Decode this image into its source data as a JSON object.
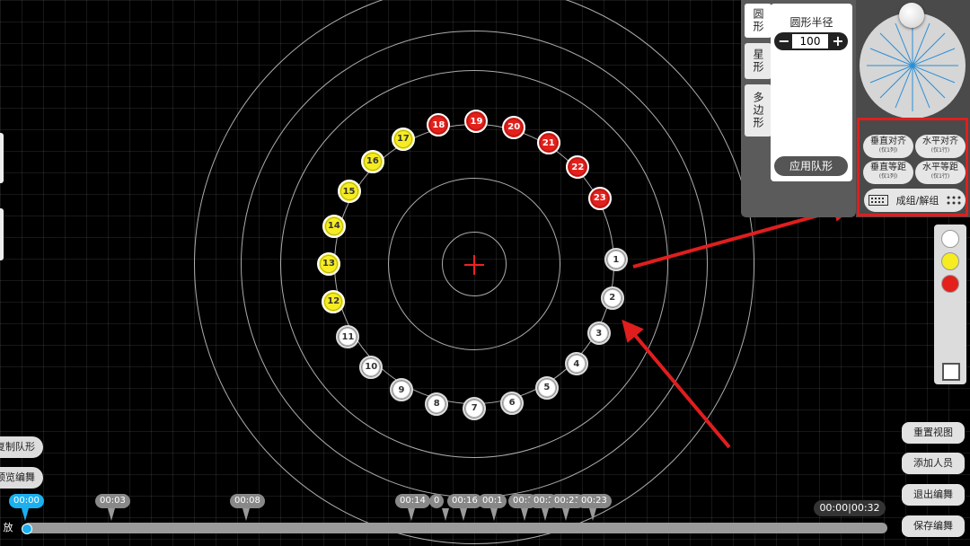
{
  "shape_tabs": [
    {
      "label": "圆形",
      "active": true
    },
    {
      "label": "星形",
      "active": false
    },
    {
      "label": "多边形",
      "active": false
    }
  ],
  "shape_settings": {
    "radius_title": "圆形半径",
    "radius_value": "100",
    "minus": "−",
    "plus": "+",
    "apply_label": "应用队形"
  },
  "align": {
    "vertical_align": {
      "label": "垂直对齐",
      "sub": "(仅1列)"
    },
    "horizontal_align": {
      "label": "水平对齐",
      "sub": "(仅1行)"
    },
    "vertical_spacing": {
      "label": "垂直等距",
      "sub": "(仅1列)"
    },
    "horizontal_spacing": {
      "label": "水平等距",
      "sub": "(仅1行)"
    },
    "group_label": "成组/解组"
  },
  "colors": {
    "white": "#ffffff",
    "yellow": "#f5ec22",
    "red": "#e3201b",
    "annotation": "#e01e1e",
    "accent": "#1bb0f0"
  },
  "dancers": [
    {
      "n": "1",
      "color": "white"
    },
    {
      "n": "2",
      "color": "white"
    },
    {
      "n": "3",
      "color": "white"
    },
    {
      "n": "4",
      "color": "white"
    },
    {
      "n": "5",
      "color": "white"
    },
    {
      "n": "6",
      "color": "white"
    },
    {
      "n": "7",
      "color": "white"
    },
    {
      "n": "8",
      "color": "white"
    },
    {
      "n": "9",
      "color": "white"
    },
    {
      "n": "10",
      "color": "white"
    },
    {
      "n": "11",
      "color": "white"
    },
    {
      "n": "12",
      "color": "yellow"
    },
    {
      "n": "13",
      "color": "yellow"
    },
    {
      "n": "14",
      "color": "yellow"
    },
    {
      "n": "15",
      "color": "yellow"
    },
    {
      "n": "16",
      "color": "yellow"
    },
    {
      "n": "17",
      "color": "yellow"
    },
    {
      "n": "18",
      "color": "red"
    },
    {
      "n": "19",
      "color": "red"
    },
    {
      "n": "20",
      "color": "red"
    },
    {
      "n": "21",
      "color": "red"
    },
    {
      "n": "22",
      "color": "red"
    },
    {
      "n": "23",
      "color": "red"
    }
  ],
  "left_buttons": {
    "copy_formation": "复制队形",
    "preview_edit": "预览编舞"
  },
  "right_buttons": {
    "reset_view": "重置视图",
    "add_member": "添加人员",
    "exit_edit": "退出编舞",
    "save_edit": "保存编舞"
  },
  "timeline": {
    "play_label": "放",
    "time_readout": "00:00|00:32",
    "markers": [
      "00:00",
      "00:03",
      "00:08",
      "00:14",
      "0",
      "00:16",
      "00:1",
      "00:1",
      "00:2",
      "00:21",
      "00:23"
    ]
  }
}
